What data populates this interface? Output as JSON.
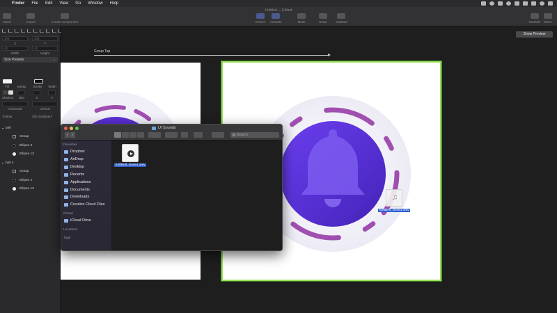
{
  "menubar": {
    "app": "Finder",
    "items": [
      "File",
      "Edit",
      "View",
      "Go",
      "Window",
      "Help"
    ]
  },
  "toolbar": {
    "window_title": "Untitled — Edited",
    "buttons": {
      "insert": "Insert",
      "import": "Import",
      "create_component": "Create Component",
      "drivers": "Drivers",
      "animate": "Animate",
      "mask": "Mask",
      "union": "Union",
      "subtract": "Subtract",
      "tutorials": "Tutorials",
      "mirror": "Mirror"
    }
  },
  "inspector": {
    "width_value": "204",
    "height_value": "203",
    "x_value": "44",
    "y_value": "44",
    "width_label": "Width",
    "height_label": "Height",
    "x_label": "X",
    "y_label": "Y",
    "size_presets": "Size Presets",
    "fill_label": "Fill",
    "media_label": "Media",
    "stroke_label": "Stroke",
    "width2_label": "Width",
    "shadow_label": "Shadow",
    "blur_label": "Blur",
    "sx_label": "X",
    "sy_label": "Y",
    "horizontal_label": "Horizontal",
    "vertical_label": "Vertical",
    "toolbar_label": "Toolbar",
    "clip_label": "Clip Sublayers"
  },
  "layers": [
    {
      "name": "bell",
      "type": "parent"
    },
    {
      "name": "Group",
      "type": "group"
    },
    {
      "name": "Ellipse 2",
      "type": "ellipse-dark"
    },
    {
      "name": "Ellipse 13",
      "type": "ellipse-white"
    },
    {
      "name": "bell 2",
      "type": "parent"
    },
    {
      "name": "Group",
      "type": "group"
    },
    {
      "name": "Ellipse 2",
      "type": "ellipse-dark"
    },
    {
      "name": "Ellipse 13",
      "type": "ellipse-white"
    }
  ],
  "canvas": {
    "show_preview": "Show Preview",
    "group_tap": "Group Tap",
    "drag_file": "SoftBell_Done1.wav"
  },
  "finder": {
    "title": "UI Sounds",
    "search_placeholder": "Search",
    "favorites_heading": "Favorites",
    "icloud_heading": "iCloud",
    "locations_heading": "Locations",
    "tags_heading": "Tags",
    "favorites": [
      "Dropbox",
      "AirDrop",
      "Desktop",
      "Recents",
      "Applications",
      "Documents",
      "Downloads",
      "Creative Cloud Files"
    ],
    "icloud": [
      "iCloud Drive"
    ],
    "file_name": "SoftBell_Done1.wav"
  },
  "colors": {
    "accent_green": "#9be05b",
    "bell_purple": "#5a2fd6",
    "ring_pink": "#a04fb0",
    "selection_blue": "#2f5fd0"
  }
}
